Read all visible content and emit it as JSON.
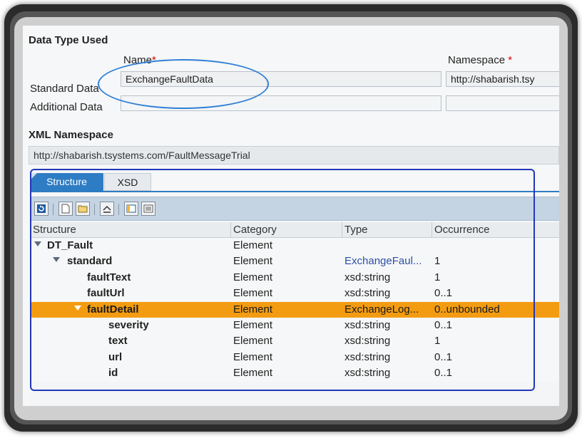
{
  "data_type_used": {
    "title": "Data Type Used",
    "name_header": "Name",
    "namespace_header": "Namespace",
    "required_marker": "*",
    "standard_label": "Standard Data",
    "standard_name": "ExchangeFaultData",
    "standard_namespace": "http://shabarish.tsy",
    "additional_label": "Additional Data",
    "additional_name": "",
    "additional_namespace": ""
  },
  "xml_namespace": {
    "title": "XML Namespace",
    "value": "http://shabarish.tsystems.com/FaultMessageTrial"
  },
  "tabs": [
    {
      "label": "Structure",
      "active": true
    },
    {
      "label": "XSD",
      "active": false
    }
  ],
  "toolbar": {
    "icons": [
      "refresh-icon",
      "new-document-icon",
      "open-folder-icon",
      "collapse-icon",
      "columns-icon",
      "settings-list-icon"
    ]
  },
  "grid": {
    "columns": [
      "Structure",
      "Category",
      "Type",
      "Occurrence"
    ],
    "rows": [
      {
        "name": "DT_Fault",
        "category": "Element",
        "type": "",
        "occurrence": ""
      },
      {
        "name": "standard",
        "category": "Element",
        "type": "ExchangeFaul...",
        "occurrence": "1"
      },
      {
        "name": "faultText",
        "category": "Element",
        "type": "xsd:string",
        "occurrence": "1"
      },
      {
        "name": "faultUrl",
        "category": "Element",
        "type": "xsd:string",
        "occurrence": "0..1"
      },
      {
        "name": "faultDetail",
        "category": "Element",
        "type": "ExchangeLog...",
        "occurrence": "0..unbounded"
      },
      {
        "name": "severity",
        "category": "Element",
        "type": "xsd:string",
        "occurrence": "0..1"
      },
      {
        "name": "text",
        "category": "Element",
        "type": "xsd:string",
        "occurrence": "1"
      },
      {
        "name": "url",
        "category": "Element",
        "type": "xsd:string",
        "occurrence": "0..1"
      },
      {
        "name": "id",
        "category": "Element",
        "type": "xsd:string",
        "occurrence": "0..1"
      }
    ]
  },
  "colors": {
    "tab_active": "#2e7cc4",
    "selected_row": "#f39c12",
    "annotation_ellipse": "#2f7fd6",
    "annotation_rect": "#2237b8"
  }
}
